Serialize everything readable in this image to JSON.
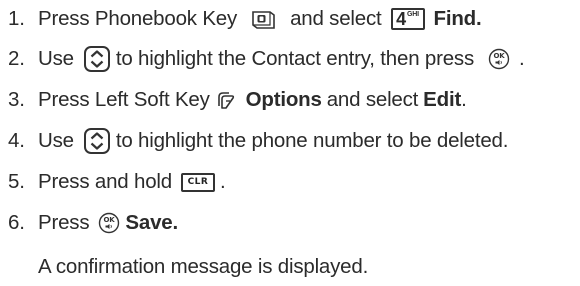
{
  "steps": [
    {
      "number": "1.",
      "parts": {
        "a": "Press Phonebook Key",
        "b": "and select",
        "key_digit": "4",
        "key_letters": "GHI",
        "c": "Find",
        "d": "."
      }
    },
    {
      "number": "2.",
      "parts": {
        "a": "Use",
        "b": "to highlight the Contact entry, then press",
        "c": "."
      }
    },
    {
      "number": "3.",
      "parts": {
        "a": "Press Left Soft Key",
        "b": "Options",
        "c": "and select",
        "d": "Edit",
        "e": "."
      }
    },
    {
      "number": "4.",
      "parts": {
        "a": "Use",
        "b": "to highlight the phone number to be deleted."
      }
    },
    {
      "number": "5.",
      "parts": {
        "a": "Press and hold",
        "key_label": "CLR",
        "b": "."
      }
    },
    {
      "number": "6.",
      "parts": {
        "a": "Press",
        "b": "Save",
        "c": "."
      }
    }
  ],
  "note": "A confirmation message is displayed.",
  "icons": {
    "phonebook_key": "phonebook-key-icon",
    "nav_key": "navigation-key-icon",
    "ok_key": "ok-key-icon",
    "left_soft_key": "left-soft-key-icon",
    "key_4ghi": "key-4-ghi-icon",
    "clr_key": "clr-key-icon"
  },
  "colors": {
    "text": "#2b2b2b",
    "background": "#ffffff"
  }
}
